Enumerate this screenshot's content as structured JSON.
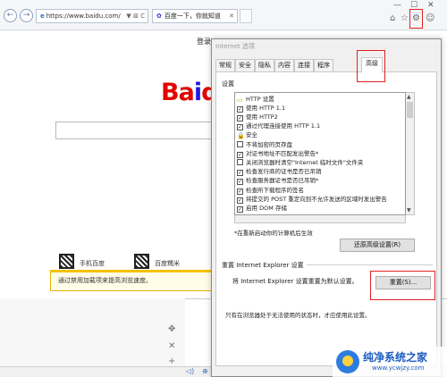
{
  "browser": {
    "address": "https://www.baidu.com/",
    "address_controls": "▼ ⊠ C",
    "tab_title": "百度一下，你就知道",
    "window_controls": {
      "minimize": "—",
      "maximize": "☐",
      "close": "✕"
    }
  },
  "page": {
    "login_link": "登录",
    "logo_ba": "Ba",
    "logo_i": "i",
    "logo_du": "du",
    "qr_labels": [
      "手机百度",
      "百度糯米"
    ],
    "notice": "通过禁用加载项来提高浏览速度。"
  },
  "dialog": {
    "title": "Internet 选项",
    "tabs": [
      "常规",
      "安全",
      "隐私",
      "内容",
      "连接",
      "程序",
      "高级"
    ],
    "settings_label": "设置",
    "settings": [
      {
        "label": "HTTP 设置",
        "kind": "category"
      },
      {
        "label": "使用 HTTP 1.1",
        "checked": true
      },
      {
        "label": "使用 HTTP2",
        "checked": true
      },
      {
        "label": "通过代理连接使用 HTTP 1.1",
        "checked": true
      },
      {
        "label": "安全",
        "kind": "category"
      },
      {
        "label": "不将加密的页存盘",
        "checked": false
      },
      {
        "label": "对证书地址不匹配发出警告*",
        "checked": true
      },
      {
        "label": "关闭浏览器时清空\"Internet 临时文件\"文件夹",
        "checked": false
      },
      {
        "label": "检查发行商的证书是否已吊销",
        "checked": true
      },
      {
        "label": "检查服务器证书是否已吊销*",
        "checked": true
      },
      {
        "label": "检查所下载程序的签名",
        "checked": true
      },
      {
        "label": "将提交的 POST 重定向到不允许发送的区域时发出警告",
        "checked": true
      },
      {
        "label": "启用 DOM 存储",
        "checked": true
      }
    ],
    "restart_note": "*在重新启动你的计算机后生效",
    "restore_button": "还原高级设置(R)",
    "reset_group_title": "重置 Internet Explorer 设置",
    "reset_text": "将 Internet Explorer 设置重置为默认设置。",
    "reset_button": "重置(S)...",
    "only_text": "只有在浏览器处于无法使用的状态时，才应使用此设置。"
  },
  "watermark": {
    "title": "纯净系统之家",
    "url": "www.ycwjzy.com"
  },
  "colors": {
    "highlight": "#e02020",
    "baidu_red": "#e10601",
    "baidu_blue": "#2319dc"
  }
}
